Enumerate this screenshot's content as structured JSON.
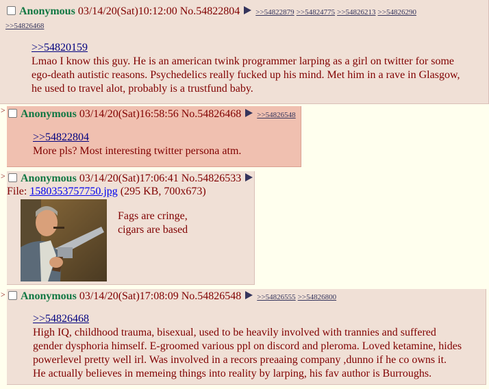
{
  "posts": [
    {
      "name": "Anonymous",
      "datetime": "03/14/20(Sat)10:12:00",
      "no": "No.54822804",
      "backlinks": [
        ">>54822879",
        ">>54824775",
        ">>54826213",
        ">>54826290",
        ">>54826468"
      ],
      "quote": ">>54820159",
      "lines": [
        "Lmao I know this guy. He is an american twink programmer larping as a girl on twitter for some",
        "ego-death autistic reasons. Psychedelics really fucked up his mind. Met him in a rave in Glasgow,",
        "he used to travel alot, probably is a trustfund baby."
      ]
    },
    {
      "name": "Anonymous",
      "datetime": "03/14/20(Sat)16:58:56",
      "no": "No.54826468",
      "backlinks": [
        ">>54826548"
      ],
      "quote": ">>54822804",
      "lines": [
        "More pls? Most interesting twitter persona atm."
      ]
    },
    {
      "name": "Anonymous",
      "datetime": "03/14/20(Sat)17:06:41",
      "no": "No.54826533",
      "file_label": "File:",
      "file_name": "1580353757750.jpg",
      "file_info": "(295 KB, 700x673)",
      "lines": [
        "Fags are cringe,",
        "cigars are based"
      ]
    },
    {
      "name": "Anonymous",
      "datetime": "03/14/20(Sat)17:08:09",
      "no": "No.54826548",
      "backlinks": [
        ">>54826555",
        ">>54826800"
      ],
      "quote": ">>54826468",
      "lines": [
        "High IQ, childhood trauma, bisexual, used to be heavily involved with trannies and suffered",
        "gender dysphoria himself. E-groomed various ppl on discord and pleroma. Loved ketamine, hides",
        "powerlevel pretty well irl. Was involved in a recors preaaing company ,dunno if he co owns it.",
        "He actually believes in memeing things into reality by larping, his fav author is Burroughs."
      ]
    }
  ],
  "reply_marker": ">",
  "colors": {
    "post_bg": "#F0E0D6",
    "highlight_bg": "#F0C0B0",
    "page_bg": "#FFFFEE",
    "name": "#117743",
    "text": "#800000",
    "link": "#34345C"
  }
}
